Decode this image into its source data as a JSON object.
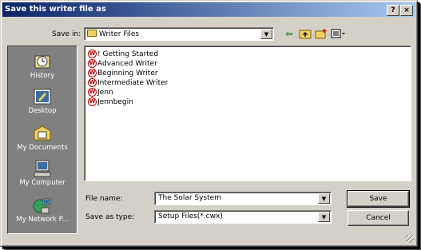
{
  "window": {
    "title": "Save this writer file as"
  },
  "titlebar_buttons": {
    "help": "?",
    "close": "×"
  },
  "save_in": {
    "label": "Save in:",
    "value": "Writer Files"
  },
  "places": [
    {
      "label": "History",
      "icon": "history-icon"
    },
    {
      "label": "Desktop",
      "icon": "desktop-icon"
    },
    {
      "label": "My Documents",
      "icon": "my-documents-icon"
    },
    {
      "label": "My Computer",
      "icon": "my-computer-icon"
    },
    {
      "label": "My Network P...",
      "icon": "network-places-icon"
    }
  ],
  "files": [
    "! Getting Started",
    "Advanced Writer",
    "Beginning Writer",
    "Intermediate Writer",
    "Jenn",
    "Jennbegin"
  ],
  "file_name": {
    "label": "File name:",
    "value": "The Solar System"
  },
  "save_as_type": {
    "label": "Save as type:",
    "value": "Setup Files(*.cwx)"
  },
  "buttons": {
    "save": "Save",
    "cancel": "Cancel"
  }
}
